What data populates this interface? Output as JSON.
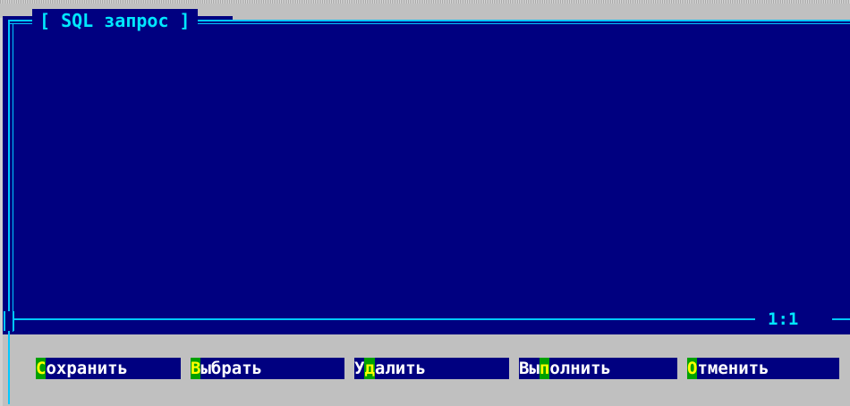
{
  "window": {
    "title": "[ SQL запрос ]",
    "cursor_position": "1:1"
  },
  "editor": {
    "text": ""
  },
  "buttons": [
    {
      "hotkey": "С",
      "rest": "охранить",
      "label": "Сохранить"
    },
    {
      "hotkey": "В",
      "rest": "ыбрать",
      "label": "Выбрать"
    },
    {
      "pre": "У",
      "hotkey": "д",
      "rest": "алить",
      "label": "Удалить"
    },
    {
      "pre": "Вы",
      "hotkey": "п",
      "rest": "олнить",
      "label": "Выполнить"
    },
    {
      "hotkey": "О",
      "rest": "тменить",
      "label": "Отменить"
    }
  ],
  "colors": {
    "background": "#c0c0c0",
    "editor": "#000080",
    "frame": "#00c8ff",
    "title_text": "#00e8ff",
    "button_text": "#ffffff",
    "hotkey_bg": "#00a000",
    "hotkey_fg": "#ffff00"
  }
}
